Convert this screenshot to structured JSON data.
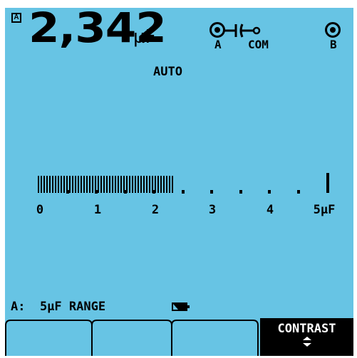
{
  "display": {
    "channel_badge": "A",
    "reading_value": "2,342",
    "reading_unit": "µF",
    "range_mode": "AUTO"
  },
  "probe": {
    "input_a_label": "A",
    "com_label": "COM",
    "input_b_label": "B",
    "icons": [
      "input-jack-icon",
      "capacitor-symbol-icon",
      "input-jack-icon"
    ]
  },
  "bargraph": {
    "scale_min": 0,
    "scale_max": 5,
    "value": 2.342,
    "scale_labels": [
      "0",
      "1",
      "2",
      "3",
      "4",
      "5µF"
    ]
  },
  "status": {
    "range_text": "A:  5µF RANGE",
    "battery_icon": "battery-icon"
  },
  "softkeys": {
    "f1_label": "",
    "f2_label": "",
    "f3_label": "",
    "f4_label": "CONTRAST",
    "f4_icon": "up-down-arrows-icon"
  },
  "colors": {
    "screen_background": "#67c4e4",
    "foreground": "#000000"
  }
}
